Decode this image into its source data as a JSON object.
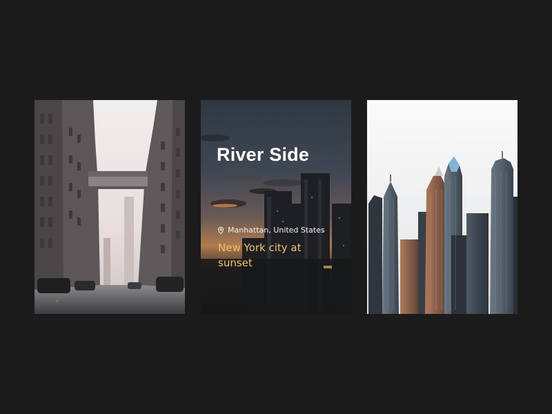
{
  "gallery": {
    "cards": [
      {
        "image": "city-street-skybridge-photo"
      },
      {
        "image": "new-york-sunset-skyline-photo",
        "title": "River Side",
        "location_icon": "map-pin-icon",
        "location": "Manhattan, United States",
        "subtitle": "New York city at sunset"
      },
      {
        "image": "skyscrapers-overcast-photo"
      }
    ],
    "colors": {
      "background": "#1b1b1b",
      "title": "#ffffff",
      "subtitle_accent": "#f2c26b"
    }
  }
}
